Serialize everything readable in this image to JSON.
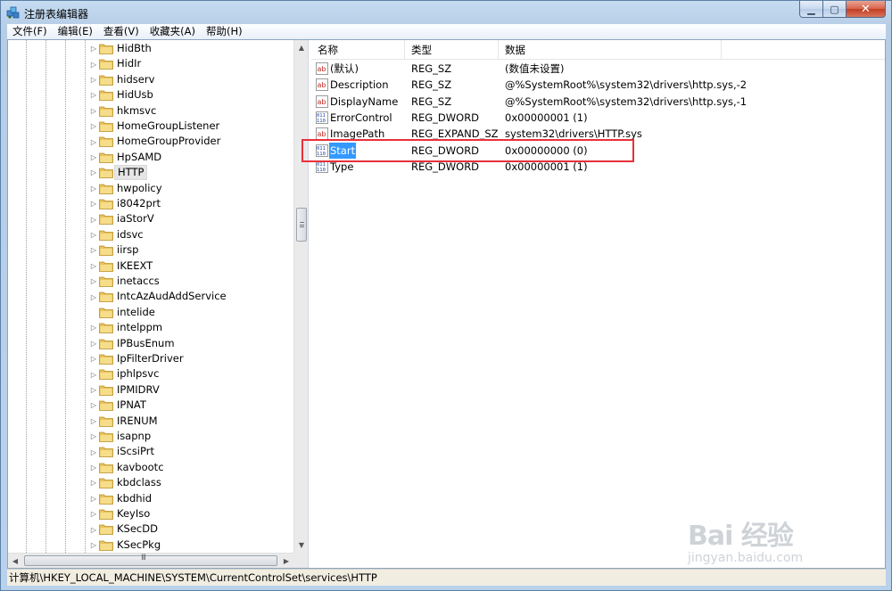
{
  "window": {
    "title": "注册表编辑器",
    "icon": "registry-editor-icon",
    "controls": {
      "minimize": "minimize-icon",
      "maximize": "maximize-icon",
      "close": "close-icon"
    }
  },
  "menubar": {
    "items": [
      "文件(F)",
      "编辑(E)",
      "查看(V)",
      "收藏夹(A)",
      "帮助(H)"
    ]
  },
  "tree": {
    "items": [
      {
        "label": "HidBth",
        "expandable": true
      },
      {
        "label": "HidIr",
        "expandable": true
      },
      {
        "label": "hidserv",
        "expandable": true
      },
      {
        "label": "HidUsb",
        "expandable": true
      },
      {
        "label": "hkmsvc",
        "expandable": true
      },
      {
        "label": "HomeGroupListener",
        "expandable": true
      },
      {
        "label": "HomeGroupProvider",
        "expandable": true
      },
      {
        "label": "HpSAMD",
        "expandable": true
      },
      {
        "label": "HTTP",
        "expandable": true,
        "selected": true
      },
      {
        "label": "hwpolicy",
        "expandable": true
      },
      {
        "label": "i8042prt",
        "expandable": true
      },
      {
        "label": "iaStorV",
        "expandable": true
      },
      {
        "label": "idsvc",
        "expandable": true
      },
      {
        "label": "iirsp",
        "expandable": true
      },
      {
        "label": "IKEEXT",
        "expandable": true
      },
      {
        "label": "inetaccs",
        "expandable": true
      },
      {
        "label": "IntcAzAudAddService",
        "expandable": true
      },
      {
        "label": "intelide",
        "expandable": false
      },
      {
        "label": "intelppm",
        "expandable": true
      },
      {
        "label": "IPBusEnum",
        "expandable": true
      },
      {
        "label": "IpFilterDriver",
        "expandable": true
      },
      {
        "label": "iphlpsvc",
        "expandable": true
      },
      {
        "label": "IPMIDRV",
        "expandable": true
      },
      {
        "label": "IPNAT",
        "expandable": true
      },
      {
        "label": "IRENUM",
        "expandable": true
      },
      {
        "label": "isapnp",
        "expandable": true
      },
      {
        "label": "iScsiPrt",
        "expandable": true
      },
      {
        "label": "kavbootc",
        "expandable": true
      },
      {
        "label": "kbdclass",
        "expandable": true
      },
      {
        "label": "kbdhid",
        "expandable": true
      },
      {
        "label": "KeyIso",
        "expandable": true
      },
      {
        "label": "KSecDD",
        "expandable": true
      },
      {
        "label": "KSecPkg",
        "expandable": true
      }
    ],
    "hscroll_thumb_text": "III"
  },
  "list": {
    "columns": [
      "名称",
      "类型",
      "数据"
    ],
    "rows": [
      {
        "icon": "string-value-icon",
        "name": "(默认)",
        "type": "REG_SZ",
        "data": "(数值未设置)"
      },
      {
        "icon": "string-value-icon",
        "name": "Description",
        "type": "REG_SZ",
        "data": "@%SystemRoot%\\system32\\drivers\\http.sys,-2"
      },
      {
        "icon": "string-value-icon",
        "name": "DisplayName",
        "type": "REG_SZ",
        "data": "@%SystemRoot%\\system32\\drivers\\http.sys,-1"
      },
      {
        "icon": "binary-value-icon",
        "name": "ErrorControl",
        "type": "REG_DWORD",
        "data": "0x00000001 (1)"
      },
      {
        "icon": "string-value-icon",
        "name": "ImagePath",
        "type": "REG_EXPAND_SZ",
        "data": "system32\\drivers\\HTTP.sys"
      },
      {
        "icon": "binary-value-icon",
        "name": "Start",
        "type": "REG_DWORD",
        "data": "0x00000000 (0)",
        "selected": true
      },
      {
        "icon": "binary-value-icon",
        "name": "Type",
        "type": "REG_DWORD",
        "data": "0x00000001 (1)"
      }
    ]
  },
  "statusbar": {
    "path": "计算机\\HKEY_LOCAL_MACHINE\\SYSTEM\\CurrentControlSet\\services\\HTTP"
  },
  "watermark": {
    "main": "Bai 经验",
    "sub": "jingyan.baidu.com"
  },
  "colors": {
    "selection": "#3399ff",
    "highlight_box": "#e8303a",
    "folder": "#e8c15a"
  }
}
